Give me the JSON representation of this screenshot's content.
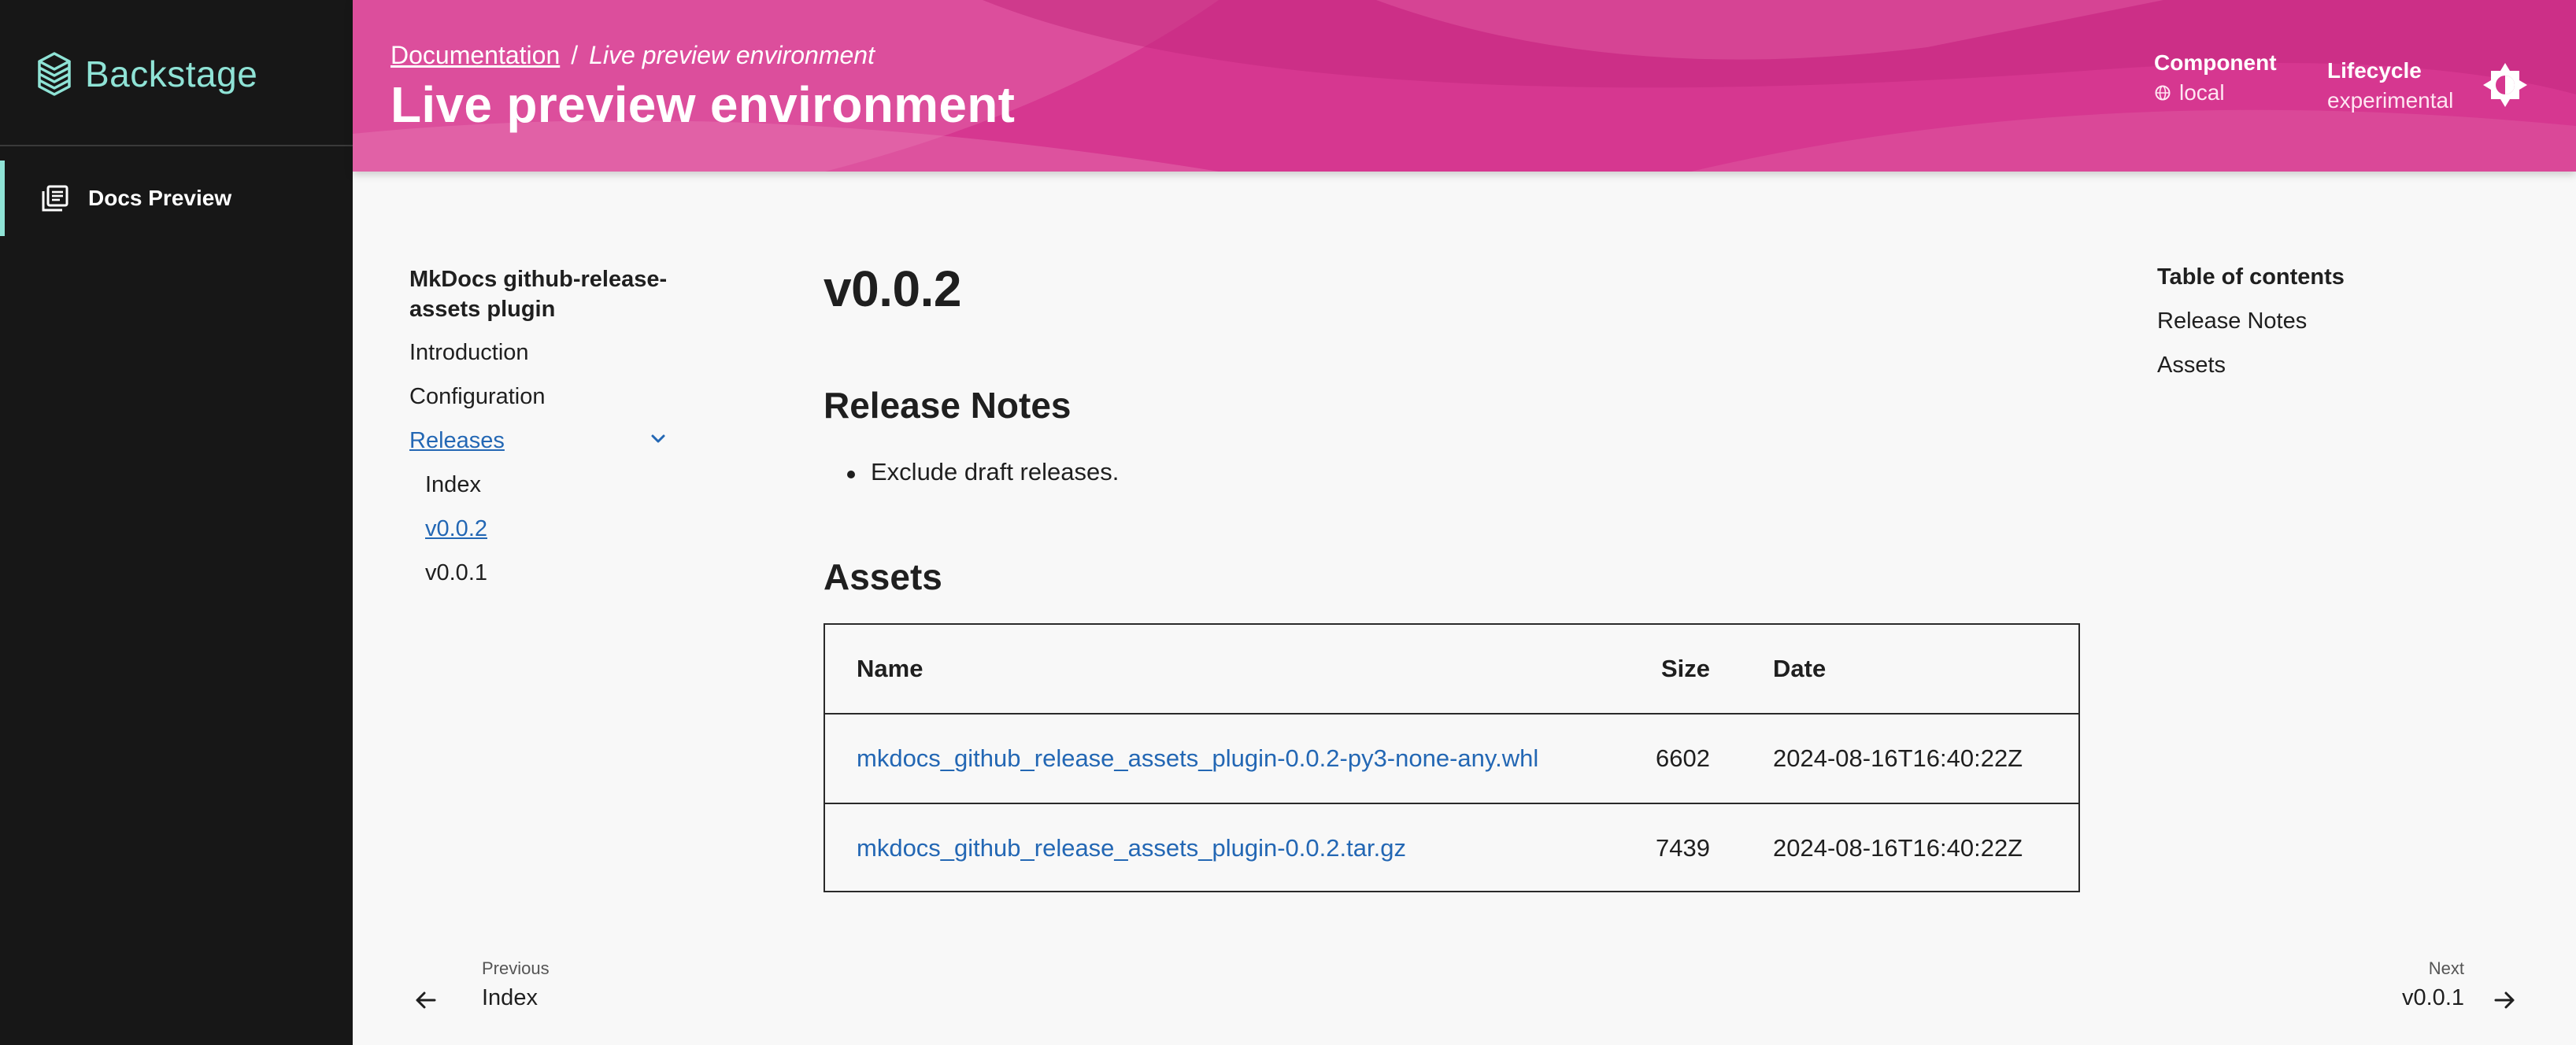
{
  "app": {
    "name": "Backstage",
    "colors": {
      "accent": "#8fe3d6",
      "header": "#d9368f",
      "link": "#2367b4",
      "sidebar": "#171717"
    }
  },
  "sidebar": {
    "items": [
      {
        "label": "Docs Preview",
        "icon": "docs-icon",
        "active": true
      }
    ]
  },
  "header": {
    "breadcrumb": {
      "link": "Documentation",
      "separator": "/",
      "current": "Live preview environment"
    },
    "title": "Live preview environment",
    "component": {
      "label": "Component",
      "value": "local",
      "icon": "globe-icon"
    },
    "lifecycle": {
      "label": "Lifecycle",
      "value": "experimental"
    },
    "theme_toggle_icon": "theme-toggle-icon"
  },
  "docnav": {
    "title": "MkDocs github-release-assets plugin",
    "items": [
      {
        "label": "Introduction"
      },
      {
        "label": "Configuration"
      },
      {
        "label": "Releases",
        "expanded": true
      },
      {
        "label": "Index"
      },
      {
        "label": "v0.0.2",
        "active": true
      },
      {
        "label": "v0.0.1"
      }
    ]
  },
  "content": {
    "heading": "v0.0.2",
    "release_notes_heading": "Release Notes",
    "release_notes": [
      "Exclude draft releases."
    ],
    "assets_heading": "Assets",
    "table": {
      "headers": [
        "Name",
        "Size",
        "Date"
      ],
      "rows": [
        {
          "name": "mkdocs_github_release_assets_plugin-0.0.2-py3-none-any.whl",
          "size": "6602",
          "date": "2024-08-16T16:40:22Z"
        },
        {
          "name": "mkdocs_github_release_assets_plugin-0.0.2.tar.gz",
          "size": "7439",
          "date": "2024-08-16T16:40:22Z"
        }
      ]
    }
  },
  "toc": {
    "title": "Table of contents",
    "items": [
      {
        "label": "Release Notes"
      },
      {
        "label": "Assets"
      }
    ]
  },
  "pager": {
    "previous": {
      "caption": "Previous",
      "title": "Index"
    },
    "next": {
      "caption": "Next",
      "title": "v0.0.1"
    }
  }
}
